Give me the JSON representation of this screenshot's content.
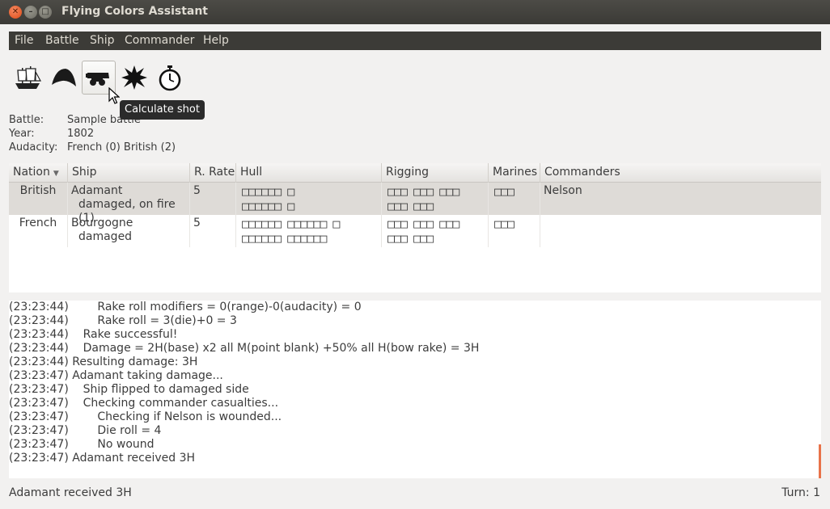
{
  "window": {
    "title": "Flying Colors Assistant"
  },
  "menu": [
    "File",
    "Battle",
    "Ship",
    "Commander",
    "Help"
  ],
  "toolbar": {
    "tooltip": "Calculate shot",
    "tools": [
      "ship-icon",
      "bicorne-hat-icon",
      "cannon-icon",
      "explosion-icon",
      "stopwatch-icon"
    ]
  },
  "info": {
    "battle_label": "Battle:",
    "battle_value": "Sample battle",
    "year_label": "Year:",
    "year_value": "1802",
    "audacity_label": "Audacity:",
    "audacity_value": "French (0)  British (2)"
  },
  "table": {
    "columns": [
      "Nation",
      "Ship",
      "R. Rate",
      "Hull",
      "Rigging",
      "Marines",
      "Commanders"
    ],
    "rows": [
      {
        "nation": "British",
        "ship": "Adamant",
        "status": "damaged, on fire (1)",
        "rate": "5",
        "hull_1": "□□□□□□ □",
        "hull_2": "□□□□□□ □",
        "rigging_1": "□□□ □□□ □□□",
        "rigging_2": "□□□ □□□",
        "marines": "□□□",
        "commanders": "Nelson"
      },
      {
        "nation": "French",
        "ship": "Bourgogne",
        "status": "damaged",
        "rate": "5",
        "hull_1": "□□□□□□ □□□□□□ □",
        "hull_2": "□□□□□□ □□□□□□",
        "rigging_1": "□□□ □□□ □□□",
        "rigging_2": "□□□ □□□",
        "marines": "□□□",
        "commanders": ""
      }
    ]
  },
  "log": [
    "(23:23:44)        Rake roll modifiers = 0(range)-0(audacity) = 0",
    "(23:23:44)        Rake roll = 3(die)+0 = 3",
    "(23:23:44)    Rake successful!",
    "(23:23:44)    Damage = 2H(base) x2 all M(point blank) +50% all H(bow rake) = 3H",
    "(23:23:44) Resulting damage: 3H",
    "(23:23:47) Adamant taking damage...",
    "(23:23:47)    Ship flipped to damaged side",
    "(23:23:47)    Checking commander casualties...",
    "(23:23:47)        Checking if Nelson is wounded...",
    "(23:23:47)        Die roll = 4",
    "(23:23:47)        No wound",
    "(23:23:47) Adamant received 3H"
  ],
  "status": {
    "message": "Adamant received 3H",
    "turn": "Turn: 1"
  }
}
